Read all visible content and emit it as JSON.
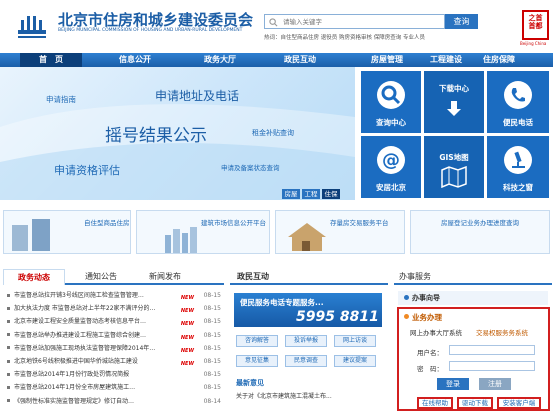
{
  "header": {
    "title": "北京市住房和城乡建设委员会",
    "subtitle": "BEIJING MUNICIPAL COMMISSION OF HOUSING AND URBAN-RURAL DEVELOPMENT",
    "search_placeholder": "请输入关键字",
    "search_button": "查询",
    "hot_label": "热词：",
    "hot_words": "自住型商品住房   退役员   购房资格审核   保障房查询   专业人员",
    "seal_text": "之首 首都",
    "seal_sub": "Beijing China"
  },
  "nav": [
    "首　页",
    "信息公开",
    "政务大厅",
    "政民互动",
    "房屋管理",
    "工程建设",
    "住房保障"
  ],
  "banner": {
    "apply_guide": "申请指南",
    "apply_address": "申请地址及电话",
    "lottery": "摇号结果公示",
    "rent_subsidy": "租金补贴查询",
    "qualification": "申请资格评估",
    "record_status": "申请及备案状态查询",
    "tabs": [
      "房屋",
      "工程",
      "住保"
    ]
  },
  "tiles": [
    {
      "label": "查询中心",
      "icon": "search-icon"
    },
    {
      "label": "下载中心",
      "icon": "download-icon"
    },
    {
      "label": "便民电话",
      "icon": "phone-icon"
    },
    {
      "label": "安居北京",
      "icon": "at-icon"
    },
    {
      "label": "GIS地图",
      "icon": "map-icon"
    },
    {
      "label": "科技之窗",
      "icon": "microscope-icon"
    }
  ],
  "strip": [
    {
      "label": "自住型商品住房"
    },
    {
      "label": "建筑市场信息公开平台"
    },
    {
      "label": "存量房交易服务平台"
    },
    {
      "label": "房屋登记业务办理进度查询"
    }
  ],
  "news": {
    "tabs": [
      "政务动态",
      "通知公告",
      "新闻发布"
    ],
    "items": [
      {
        "title": "市监督总站拉开铺3号线区间施工检查监督管理…",
        "date": "08-15",
        "new": true
      },
      {
        "title": "加大执法力度  市监督总站对上半年22家不满评分的…",
        "date": "08-15",
        "new": true
      },
      {
        "title": "北京市建设工程安全质量监督动态考核信息平台…",
        "date": "08-15",
        "new": true
      },
      {
        "title": "市监督总站举办推进建设工程施工监督综合创建…",
        "date": "08-15",
        "new": true
      },
      {
        "title": "市监督总站加强施工现场执法监督管理保障2014年…",
        "date": "08-15",
        "new": true
      },
      {
        "title": "北京地铁6号线积极推进中国华侨城站施工建设",
        "date": "08-15",
        "new": true
      },
      {
        "title": "市监督总站2014年1月份行政处罚情况简报",
        "date": "08-15",
        "new": false
      },
      {
        "title": "市监督总站2014年1月份全市房屋建筑施工…",
        "date": "08-15",
        "new": false
      },
      {
        "title": "《强制性标准实施监督管理规定》修订自动…",
        "date": "08-14",
        "new": false
      }
    ]
  },
  "interaction": {
    "tab": "政民互动",
    "hotline_title": "便民服务电话专题服务...",
    "hotline_number": "5995 8811",
    "buttons": [
      "咨询解答",
      "投诉举报",
      "网上访谈",
      "意见征集",
      "民意调查",
      "建议提案"
    ],
    "latest_title": "最新意见",
    "latest_item": "关于对《北京市建筑施工混凝土布..."
  },
  "service": {
    "title": "办事服务",
    "guide": "办事向导",
    "business": "业务办理",
    "system_label": "网上办事大厅系统",
    "system_link": "交易权服务务系统",
    "username_label": "用户名：",
    "password_label": "密　码：",
    "login": "登录",
    "register": "注册",
    "links": [
      "在线帮助",
      "驱动下载",
      "安装客户端"
    ]
  },
  "colors": {
    "primary": "#1b6cc1",
    "nav": "#2e7fd1",
    "alert": "#d21f1f"
  }
}
